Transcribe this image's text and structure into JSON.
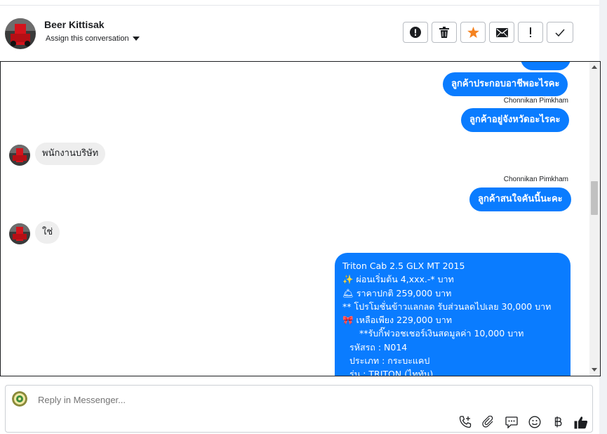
{
  "header": {
    "contact_name": "Beer Kittisak",
    "assign_label": "Assign this conversation",
    "actions": [
      {
        "name": "mark-spam-button",
        "icon": "exclamation-circle-icon"
      },
      {
        "name": "delete-button",
        "icon": "trash-icon"
      },
      {
        "name": "star-button",
        "icon": "star-icon"
      },
      {
        "name": "mark-unread-button",
        "icon": "envelope-icon"
      },
      {
        "name": "follow-up-button",
        "icon": "exclamation-icon"
      },
      {
        "name": "mark-done-button",
        "icon": "check-icon"
      }
    ]
  },
  "thread": {
    "m1": "ลูกค้าประกอบอาชีพอะไรคะ",
    "sender1": "Chonnikan Pimkham",
    "m2": "ลูกค้าอยู่จังหวัดอะไรคะ",
    "in1": "พนักงานบริษัท",
    "sender2": "Chonnikan Pimkham",
    "m3": "ลูกค้าสนใจคันนี้นะคะ",
    "in2": "ใช่",
    "product": {
      "line1": "Triton Cab 2.5 GLX MT 2015",
      "line2": "✨ ผ่อนเริ่มต้น 4,xxx.-* บาท",
      "line3": "🛎 ราคาปกติ 259,000 บาท",
      "line4": "** โปรโมชั่นข้าวแลกลด รับส่วนลดไปเลย 30,000 บาท",
      "line5": "🎀 เหลือเพียง 229,000 บาท",
      "line6": "**รับกิ๊ฟวอชเชอร์เงินสดมูลค่า 10,000 บาท",
      "line7": "รหัสรถ : N014",
      "line8": "ประเภท : กระบะแคป",
      "line9": "รุ่น : TRITON (ไททัน)"
    }
  },
  "composer": {
    "placeholder": "Reply in Messenger...",
    "tools": [
      "phone-plus-icon",
      "paperclip-icon",
      "saved-reply-icon",
      "emoji-icon",
      "baht-icon",
      "thumbs-up-icon"
    ]
  },
  "colors": {
    "outgoing_bubble": "#0a7cff",
    "incoming_bubble": "#eeeeee",
    "star": "#f5821f"
  }
}
